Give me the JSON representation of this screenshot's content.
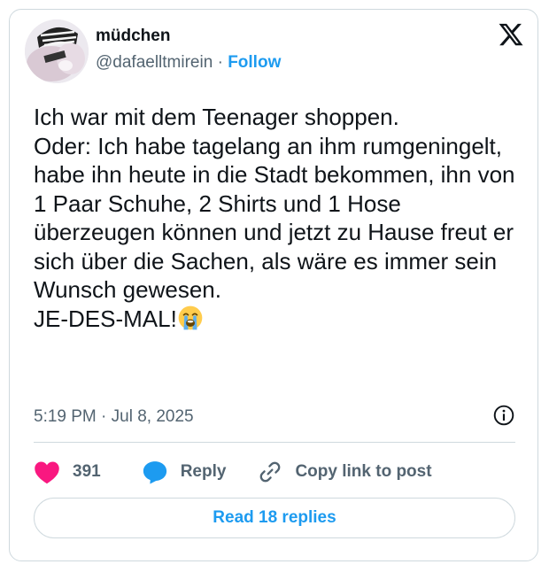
{
  "author": {
    "display_name": "müdchen",
    "handle": "@dafaelltmirein",
    "separator": "·",
    "follow_label": "Follow"
  },
  "tweet": {
    "text": "Ich war mit dem Teenager shoppen.\nOder: Ich habe tagelang an ihm rumgeningelt, habe ihn heute in die Stadt bekommen, ihn von 1 Paar Schuhe, 2 Shirts und 1 Hose überzeugen können und jetzt zu Hause freut er sich über die Sachen, als wäre es immer sein Wunsch gewesen.\nJE-DES-MAL!",
    "emoji": "loudly-crying-face-icon",
    "timestamp": "5:19 PM · Jul 8, 2025"
  },
  "actions": {
    "likes_count": "391",
    "reply_label": "Reply",
    "copy_link_label": "Copy link to post",
    "read_replies_label": "Read 18 replies"
  },
  "colors": {
    "accent": "#1d9bf0",
    "like": "#f91880",
    "text": "#0f1419",
    "secondary": "#536471",
    "border": "#cfd9de"
  }
}
